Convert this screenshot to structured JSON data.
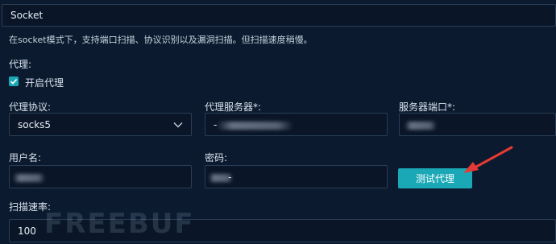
{
  "mode_select": {
    "value": "Socket"
  },
  "mode_note": "在socket模式下，支持端口扫描、协议识别以及漏洞扫描。但扫描速度稍慢。",
  "proxy": {
    "section_label": "代理:",
    "enable_label": "开启代理",
    "enabled": true,
    "protocol_label": "代理协议:",
    "protocol_value": "socks5",
    "server_label": "代理服务器*:",
    "server_value": "-",
    "port_label": "服务器端口*:",
    "username_label": "用户名:",
    "password_label": "密码:",
    "password_value": "-",
    "test_button": "测试代理"
  },
  "scan_rate": {
    "label": "扫描速率:",
    "value": "100"
  },
  "watermark": "FREEBUF",
  "colors": {
    "accent": "#1ba8b6",
    "arrow": "#e53935",
    "background": "#0b1a2e"
  }
}
